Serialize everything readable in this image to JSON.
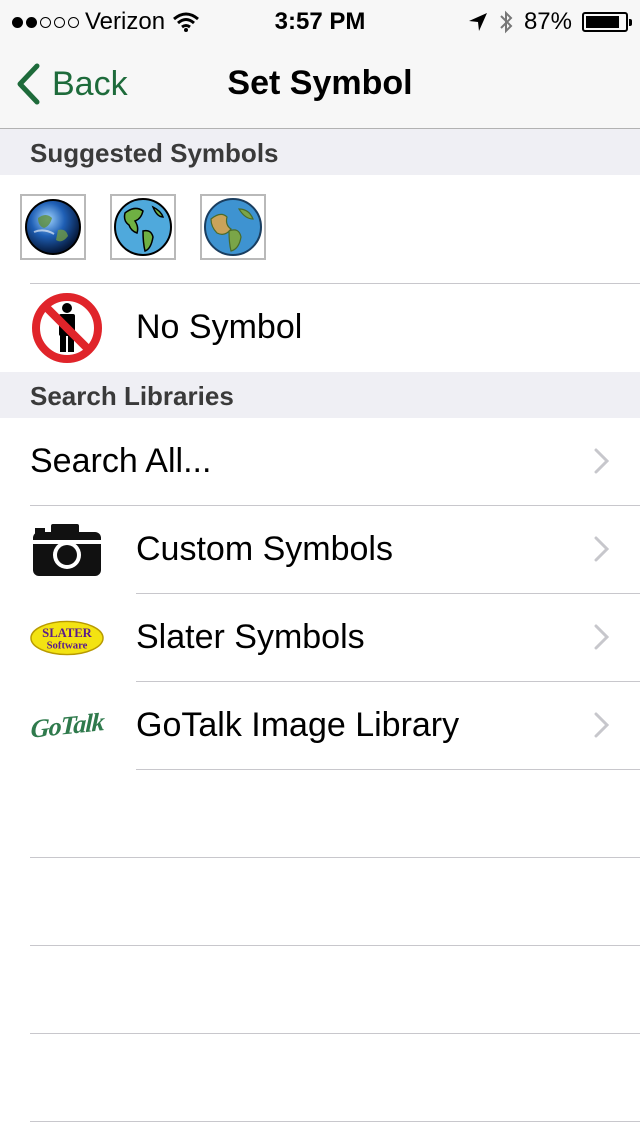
{
  "status_bar": {
    "carrier": "Verizon",
    "time": "3:57 PM",
    "battery": "87%",
    "battery_level": 0.87,
    "signal_bars_filled": 2,
    "signal_bars_total": 5
  },
  "nav": {
    "back_label": "Back",
    "title": "Set Symbol",
    "accent_color": "#1e6b3b"
  },
  "suggested": {
    "header": "Suggested Symbols",
    "thumbnails": [
      "globe-photo-icon",
      "globe-drawing-icon",
      "globe-cartoon-icon"
    ]
  },
  "no_symbol": {
    "label": "No Symbol",
    "icon": "no-person-icon"
  },
  "libraries": {
    "header": "Search Libraries",
    "items": [
      {
        "label": "Search All...",
        "icon": ""
      },
      {
        "label": "Custom Symbols",
        "icon": "camera-icon"
      },
      {
        "label": "Slater Symbols",
        "icon": "slater-software-logo",
        "logo_text_1": "SLATER",
        "logo_text_2": "Software"
      },
      {
        "label": "GoTalk Image Library",
        "icon": "gotalk-logo",
        "logo_text": "GoTalk"
      }
    ]
  }
}
